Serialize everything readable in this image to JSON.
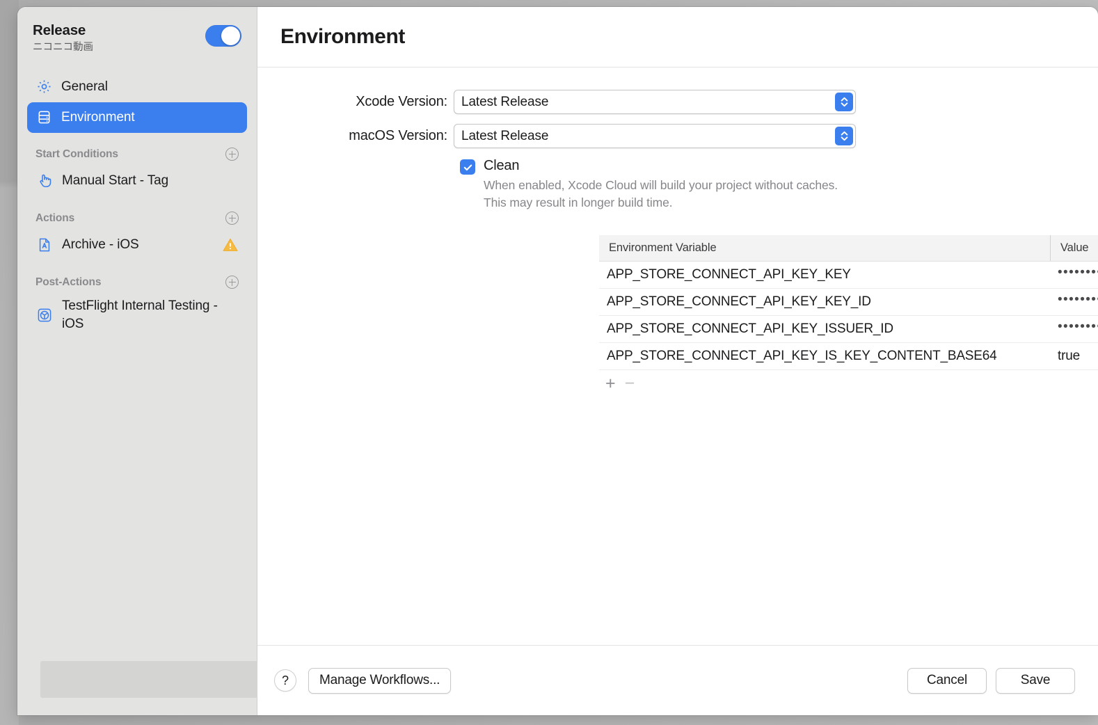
{
  "sidebar": {
    "workflow_name": "Release",
    "workflow_subtitle": "ニコニコ動画",
    "enabled_toggle": "on",
    "nav": [
      {
        "icon": "gear-icon",
        "label": "General",
        "selected": false
      },
      {
        "icon": "server-rack-icon",
        "label": "Environment",
        "selected": true
      }
    ],
    "groups": [
      {
        "title": "Start Conditions",
        "add_label": "+",
        "items": [
          {
            "icon": "pointing-hand-icon",
            "label": "Manual Start - Tag",
            "warning": false
          }
        ]
      },
      {
        "title": "Actions",
        "add_label": "+",
        "items": [
          {
            "icon": "archive-document-icon",
            "label": "Archive - iOS",
            "warning": true
          }
        ]
      },
      {
        "title": "Post-Actions",
        "add_label": "+",
        "items": [
          {
            "icon": "testflight-icon",
            "label": "TestFlight Internal Testing - iOS",
            "warning": false
          }
        ]
      }
    ]
  },
  "pane": {
    "title": "Environment",
    "fields": [
      {
        "label": "Xcode Version:",
        "value": "Latest Release"
      },
      {
        "label": "macOS Version:",
        "value": "Latest Release"
      }
    ],
    "clean": {
      "checked": true,
      "label": "Clean",
      "description": "When enabled, Xcode Cloud will build your project without caches. This may result in longer build time."
    },
    "table": {
      "columns": [
        "Environment Variable",
        "Value"
      ],
      "rows": [
        {
          "name": "APP_STORE_CONNECT_API_KEY_KEY",
          "value": "••••••••••",
          "masked": true
        },
        {
          "name": "APP_STORE_CONNECT_API_KEY_KEY_ID",
          "value": "••••••••••",
          "masked": true
        },
        {
          "name": "APP_STORE_CONNECT_API_KEY_ISSUER_ID",
          "value": "••••••••••",
          "masked": true
        },
        {
          "name": "APP_STORE_CONNECT_API_KEY_IS_KEY_CONTENT_BASE64",
          "value": "true",
          "masked": false
        }
      ],
      "add_label": "+",
      "remove_label": "−"
    }
  },
  "footer": {
    "help_label": "?",
    "manage_label": "Manage Workflows...",
    "cancel_label": "Cancel",
    "save_label": "Save"
  },
  "colors": {
    "accent": "#3b7eee",
    "warning": "#f5bb42",
    "sidebar_bg": "#e3e3e1"
  }
}
